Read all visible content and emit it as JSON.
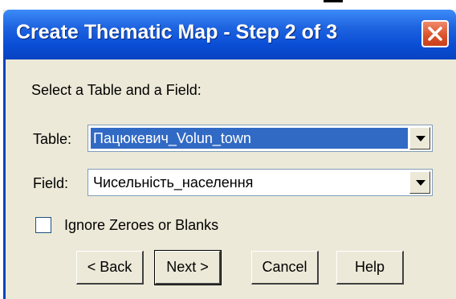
{
  "window": {
    "title": "Create Thematic Map - Step 2 of 3"
  },
  "dialog": {
    "instruction": "Select a Table and a Field:",
    "table_label": "Table:",
    "table_value": "Пацюкевич_Volun_town",
    "field_label": "Field:",
    "field_value": "Чисельність_населення",
    "ignore_zeroes_label": "Ignore Zeroes or Blanks",
    "ignore_zeroes_checked": false
  },
  "buttons": {
    "back": "< Back",
    "next": "Next >",
    "cancel": "Cancel",
    "help": "Help"
  },
  "colors": {
    "titlebar": "#0a4ed6",
    "selection": "#316ac5",
    "dialog_bg": "#ece9d8",
    "close_button": "#d9502a"
  }
}
